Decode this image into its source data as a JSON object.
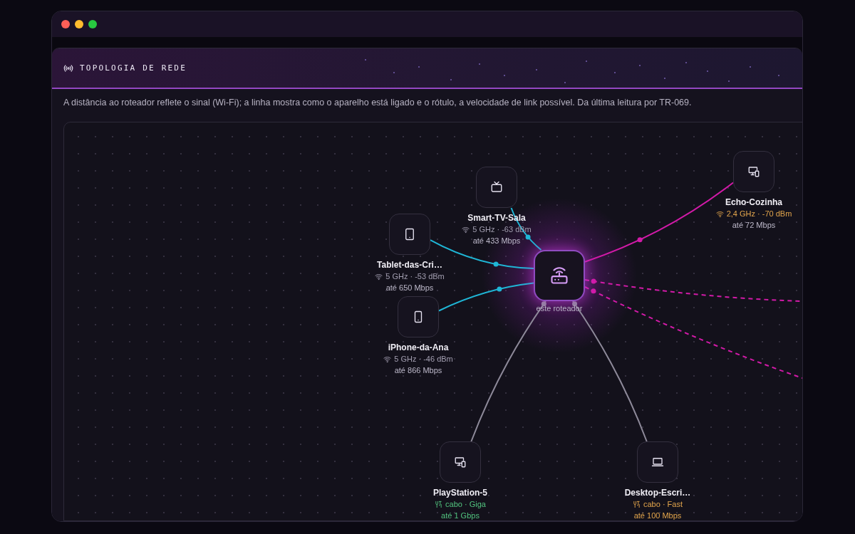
{
  "header": {
    "title": "TOPOLOGIA DE REDE"
  },
  "description": "A distância ao roteador reflete o sinal (Wi-Fi); a linha mostra como o aparelho está ligado e o rótulo, a velocidade de link possível. Da última leitura por TR-069.",
  "router": {
    "label": "este roteador"
  },
  "devices": [
    {
      "name": "Smart-TV-Sala",
      "kind": "tv",
      "detail": "5 GHz · -63 dBm",
      "speed": "até 433 Mbps",
      "color": "#a29eb0",
      "link": {
        "cable": false,
        "color": "#1fb6d6"
      }
    },
    {
      "name": "Tablet-das-Cri…",
      "kind": "tablet",
      "detail": "5 GHz · -53 dBm",
      "speed": "até 650 Mbps",
      "color": "#a29eb0",
      "link": {
        "cable": false,
        "color": "#1fb6d6"
      }
    },
    {
      "name": "iPhone-da-Ana",
      "kind": "phone",
      "detail": "5 GHz · -46 dBm",
      "speed": "até 866 Mbps",
      "color": "#a29eb0",
      "link": {
        "cable": false,
        "color": "#1fb6d6"
      }
    },
    {
      "name": "Echo-Cozinha",
      "kind": "devices",
      "detail": "2,4 GHz · -70 dBm",
      "speed": "até 72 Mbps",
      "color": "#e2a54c",
      "link": {
        "cable": false,
        "color": "#d21aa8"
      }
    },
    {
      "name": "PlayStation-5",
      "kind": "devices",
      "detail": "cabo · Giga",
      "speed": "até 1 Gbps",
      "color": "#52c47f",
      "link": {
        "cable": true,
        "color": "#8e8a9a"
      }
    },
    {
      "name": "Desktop-Escri…",
      "kind": "laptop",
      "detail": "cabo · Fast",
      "speed": "até 100 Mbps",
      "color": "#e2a54c",
      "link": {
        "cable": true,
        "color": "#8e8a9a"
      }
    }
  ],
  "extra_links": [
    {
      "color": "#d21aa8"
    },
    {
      "color": "#d21aa8"
    }
  ]
}
